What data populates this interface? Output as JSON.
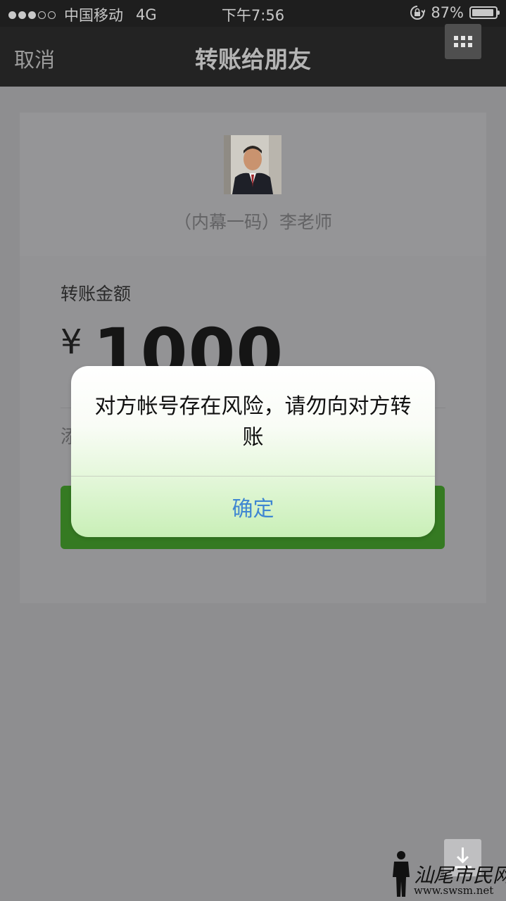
{
  "status_bar": {
    "carrier": "中国移动",
    "network": "4G",
    "time": "下午7:56",
    "battery": "87%",
    "battery_level": 0.87
  },
  "nav": {
    "cancel": "取消",
    "title": "转账给朋友"
  },
  "payee": {
    "name": "（内幕一码）李老师"
  },
  "transfer": {
    "amount_label": "转账金额",
    "currency": "¥",
    "amount": "1000",
    "remark_partial": "添"
  },
  "dialog": {
    "message": "对方帐号存在风险，请勿向对方转账",
    "ok": "确定"
  },
  "watermark": {
    "brand": "汕尾市民网",
    "site": "www.swsm.net"
  }
}
